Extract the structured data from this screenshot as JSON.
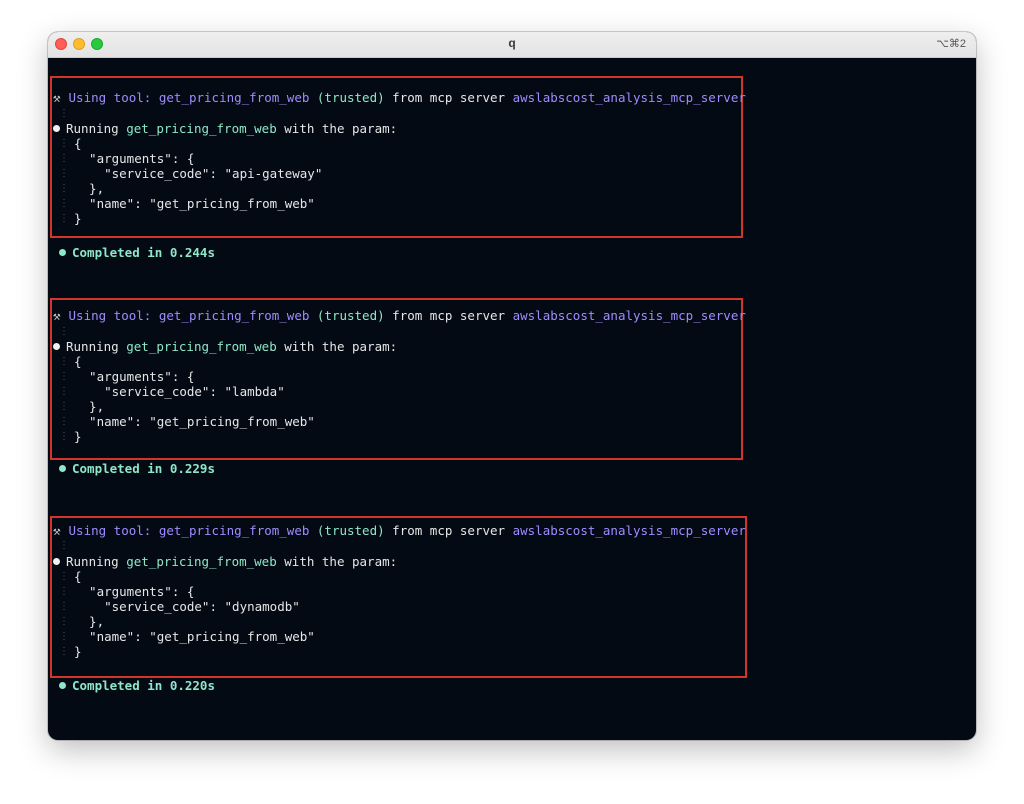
{
  "window": {
    "title": "q",
    "shortcut": "⌥⌘2"
  },
  "tool_calls": [
    {
      "prefix": "Using tool:",
      "tool_name": "get_pricing_from_web",
      "trusted": "(trusted)",
      "from_text": "from mcp server",
      "server": "awslabscost_analysis_mcp_server",
      "running_prefix": "Running",
      "running_tool": "get_pricing_from_web",
      "running_suffix": "with the param:",
      "json_lines": [
        "{",
        "  \"arguments\": {",
        "    \"service_code\": \"api-gateway\"",
        "  },",
        "  \"name\": \"get_pricing_from_web\"",
        "}"
      ],
      "completed": "Completed in 0.244s"
    },
    {
      "prefix": "Using tool:",
      "tool_name": "get_pricing_from_web",
      "trusted": "(trusted)",
      "from_text": "from mcp server",
      "server": "awslabscost_analysis_mcp_server",
      "running_prefix": "Running",
      "running_tool": "get_pricing_from_web",
      "running_suffix": "with the param:",
      "json_lines": [
        "{",
        "  \"arguments\": {",
        "    \"service_code\": \"lambda\"",
        "  },",
        "  \"name\": \"get_pricing_from_web\"",
        "}"
      ],
      "completed": "Completed in 0.229s"
    },
    {
      "prefix": "Using tool:",
      "tool_name": "get_pricing_from_web",
      "trusted": "(trusted)",
      "from_text": "from mcp server",
      "server": "awslabscost_analysis_mcp_server",
      "running_prefix": "Running",
      "running_tool": "get_pricing_from_web",
      "running_suffix": "with the param:",
      "json_lines": [
        "{",
        "  \"arguments\": {",
        "    \"service_code\": \"dynamodb\"",
        "  },",
        "  \"name\": \"get_pricing_from_web\"",
        "}"
      ],
      "completed": "Completed in 0.220s"
    }
  ],
  "colors": {
    "background": "#040a14",
    "accent_purple": "#9e8cff",
    "accent_green": "#8ee7c8",
    "highlight_border": "#d4352a"
  },
  "icons": {
    "tool": "hammer-wrench-icon"
  }
}
